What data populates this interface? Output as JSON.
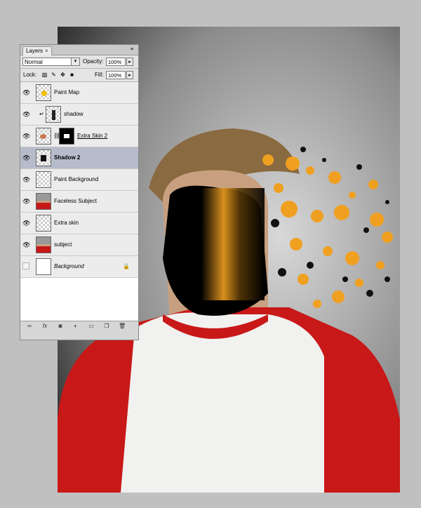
{
  "panel": {
    "tab_label": "Layers",
    "tab_close": "×",
    "menu_glyph": "≡",
    "blend_mode": "Normal",
    "opacity_label": "Opacity:",
    "opacity_value": "100%",
    "lock_label": "Lock:",
    "fill_label": "Fill:",
    "fill_value": "100%"
  },
  "layers": [
    {
      "name": "Paint Map",
      "visible": true,
      "thumb": "checker-yellow",
      "selected": false
    },
    {
      "name": "shadow",
      "visible": true,
      "thumb": "checker-shadow",
      "clipped": true,
      "selected": false
    },
    {
      "name": "Extra Skin 2",
      "visible": true,
      "thumb": "checker-skin",
      "mask": true,
      "underline": true,
      "selected": false
    },
    {
      "name": "Shadow 2",
      "visible": true,
      "thumb": "checker-dark",
      "bold": true,
      "selected": true
    },
    {
      "name": "Paint Background",
      "visible": true,
      "thumb": "checker",
      "selected": false
    },
    {
      "name": "Faceless Subject",
      "visible": true,
      "thumb": "photo",
      "selected": false
    },
    {
      "name": "Extra skin",
      "visible": true,
      "thumb": "checker",
      "selected": false
    },
    {
      "name": "subject",
      "visible": true,
      "thumb": "photo",
      "selected": false
    },
    {
      "name": "Background",
      "visible": false,
      "thumb": "white",
      "italic": true,
      "locked": true,
      "selected": false
    }
  ],
  "footer_icons": [
    "link-icon",
    "fx-icon",
    "mask-icon",
    "adjustment-icon",
    "group-icon",
    "new-layer-icon",
    "trash-icon"
  ],
  "colors": {
    "accent_orange": "#f0a020",
    "shirt_red": "#c81818",
    "selection": "#b7bccb"
  }
}
